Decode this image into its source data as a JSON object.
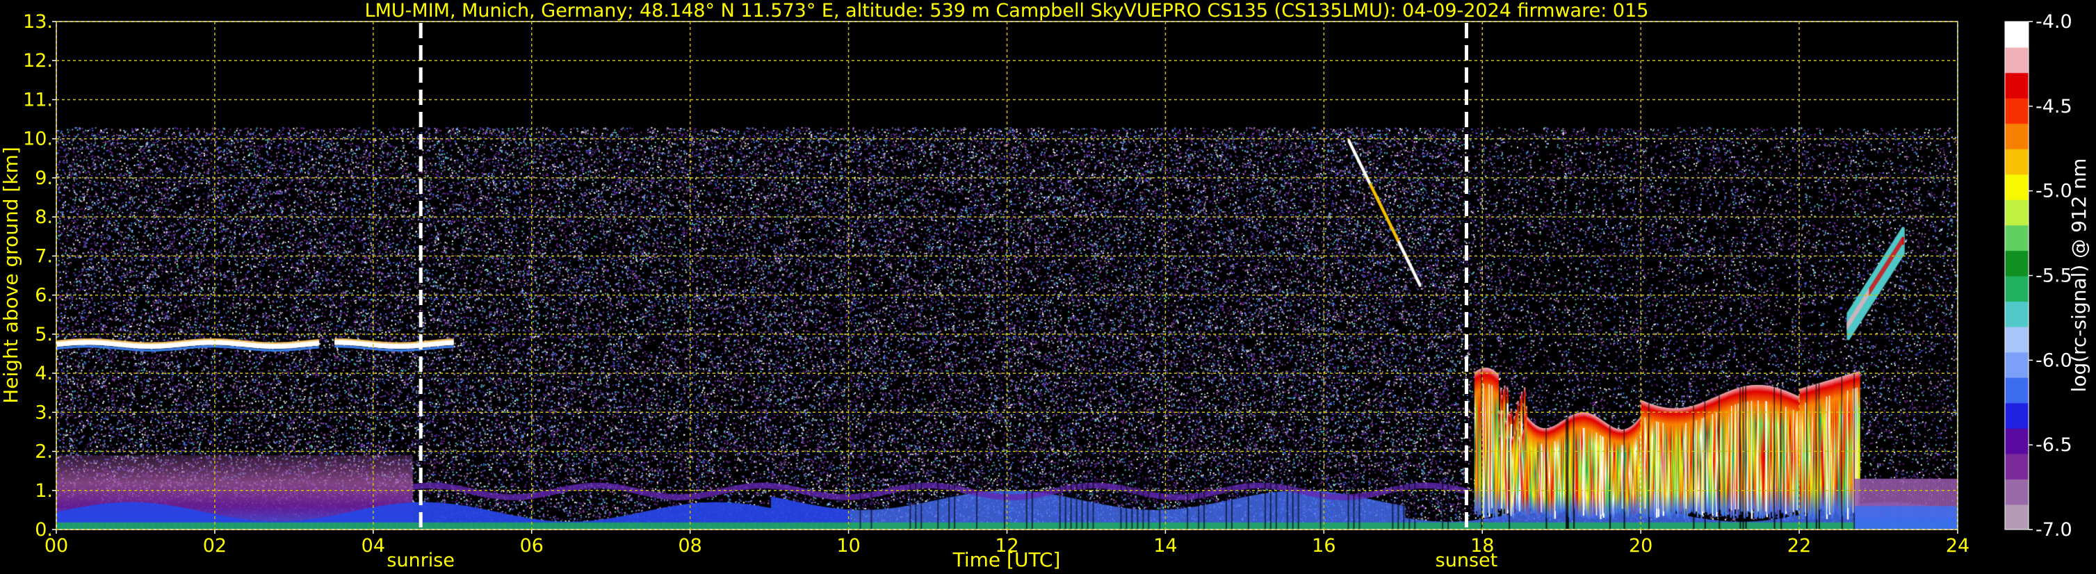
{
  "chart_data": {
    "type": "heatmap",
    "title": "LMU-MIM, Munich, Germany; 48.148° N 11.573° E, altitude: 539 m    Campbell SkyVUEPRO CS135 (CS135LMU): 04-09-2024    firmware: 015",
    "xlabel": "Time [UTC]",
    "ylabel": "Height above ground [km]",
    "xlim": [
      0,
      24
    ],
    "ylim": [
      0,
      13
    ],
    "x_ticks": [
      0,
      2,
      4,
      6,
      8,
      10,
      12,
      14,
      16,
      18,
      20,
      22,
      24
    ],
    "x_tick_labels": [
      "00",
      "02",
      "04",
      "06",
      "08",
      "10",
      "12",
      "14",
      "16",
      "18",
      "20",
      "22",
      "24"
    ],
    "y_ticks": [
      0,
      1,
      2,
      3,
      4,
      5,
      6,
      7,
      8,
      9,
      10,
      11,
      12,
      13
    ],
    "y_tick_labels": [
      "0.",
      "1.",
      "2.",
      "3.",
      "4.",
      "5.",
      "6.",
      "7.",
      "8.",
      "9.",
      "10.",
      "11.",
      "12.",
      "13."
    ],
    "grid": true,
    "data_top_km": 10.3,
    "markers": [
      {
        "label": "sunrise",
        "x": 4.6
      },
      {
        "label": "sunset",
        "x": 17.8
      }
    ],
    "colorbar": {
      "label": "log(rc-signal) @ 912 nm",
      "range": [
        -7.0,
        -4.0
      ],
      "ticks": [
        -4.0,
        -4.5,
        -5.0,
        -5.5,
        -6.0,
        -6.5,
        -7.0
      ],
      "tick_labels": [
        "-4.0",
        "-4.5",
        "-5.0",
        "-5.5",
        "-6.0",
        "-6.5",
        "-7.0"
      ],
      "colors": [
        "#b49ab4",
        "#9a6aa8",
        "#7a2a9a",
        "#5a0aa0",
        "#2020e0",
        "#3c6cf0",
        "#7ca0f8",
        "#a8c4f8",
        "#50c8c8",
        "#20b060",
        "#109020",
        "#60d060",
        "#c0f040",
        "#f8f800",
        "#f8c000",
        "#f88000",
        "#f83000",
        "#e00000",
        "#f0b0b8",
        "#ffffff"
      ]
    },
    "features": [
      {
        "name": "cloud_layer",
        "t_start": 0.0,
        "t_end": 5.0,
        "height_km": 4.75
      },
      {
        "name": "boundary_layer",
        "t_start": 0.0,
        "t_end": 4.5,
        "height_km": 1.8
      },
      {
        "name": "convective_clouds",
        "t_start": 17.9,
        "t_end": 22.7,
        "base_km": 0.3,
        "top_km": 4.2
      },
      {
        "name": "virga_streak",
        "t_start": 16.3,
        "t_end": 17.2,
        "base_km": 6.3,
        "top_km": 10.0
      },
      {
        "name": "elevated_cloud",
        "t_start": 22.6,
        "t_end": 23.3,
        "base_km": 5.2,
        "top_km": 7.4
      }
    ]
  }
}
